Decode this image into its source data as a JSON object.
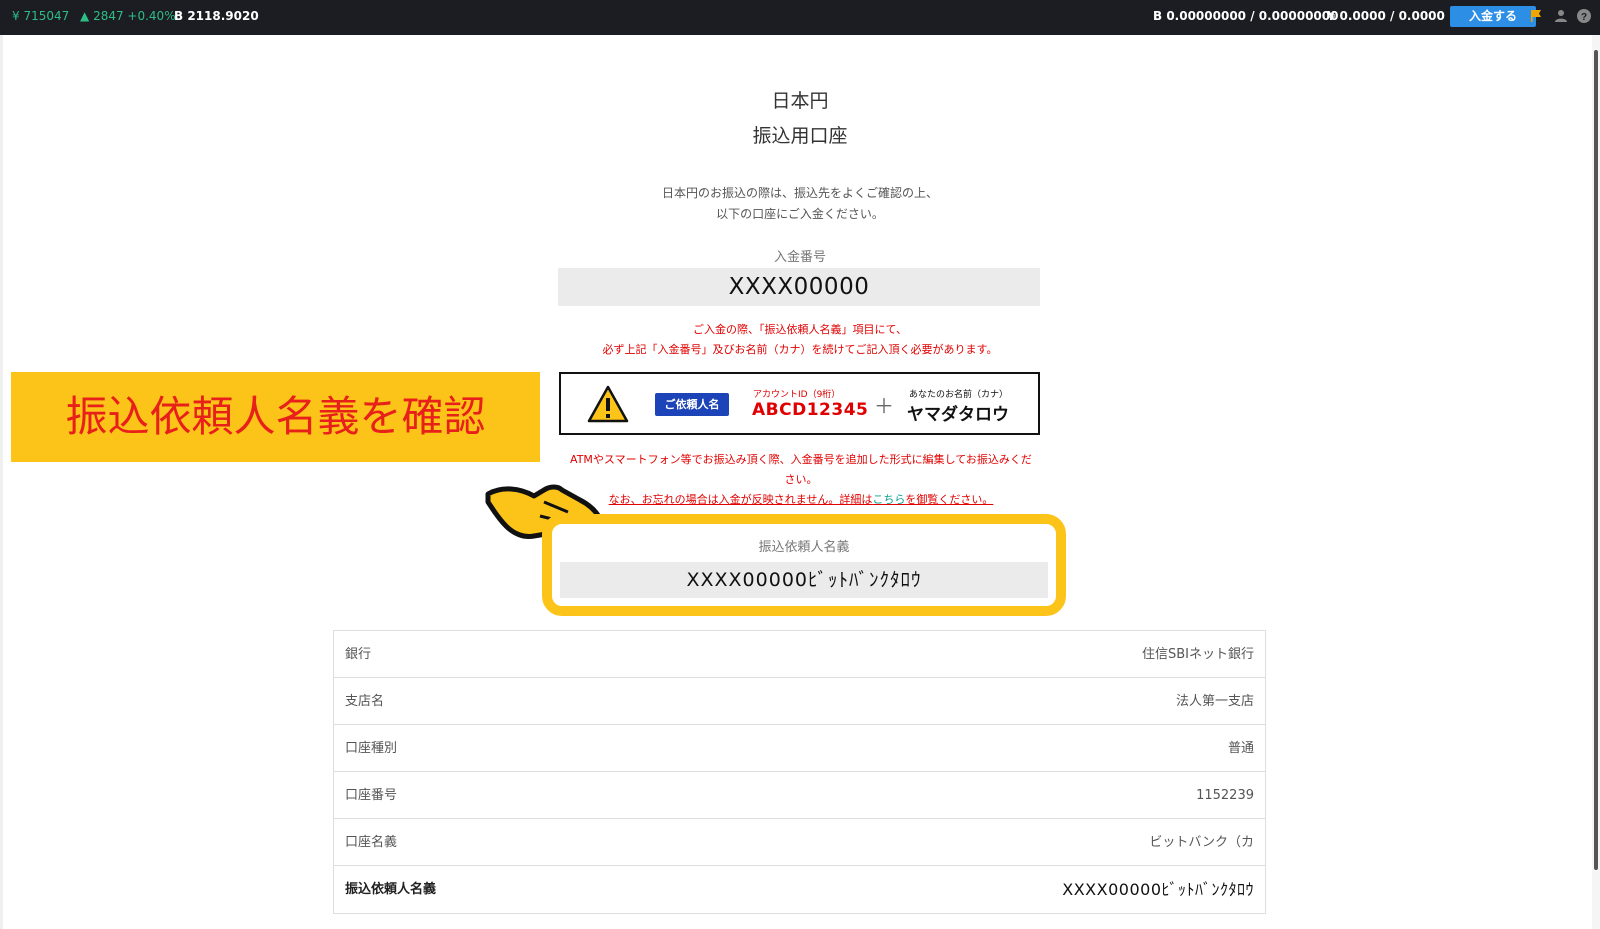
{
  "topbar": {
    "jpy_rate": "¥ 715047",
    "change": "2847 +0.40%",
    "btc_rate": "B 2118.9020",
    "btc_balance": "B 0.00000000 / 0.00000000",
    "jpy_balance": "¥ 0.0000 / 0.0000",
    "deposit_button": "入金する"
  },
  "header": {
    "title1": "日本円",
    "title2": "振込用口座"
  },
  "description": {
    "line1": "日本円のお振込の際は、振込先をよくご確認の上、",
    "line2": "以下の口座にご入金ください。"
  },
  "deposit_number": {
    "label": "入金番号",
    "value": "XXXX00000"
  },
  "notice": {
    "line1": "ご入金の際、「振込依頼人名義」項目にて、",
    "line2": "必ず上記「入金番号」及びお名前（カナ）を続けてご記入頂く必要があります。"
  },
  "example": {
    "tag": "ご依頼人名",
    "account_label": "アカウントID（9桁）",
    "account_value": "ABCD12345",
    "plus": "＋",
    "name_label": "あなたのお名前（カナ）",
    "name_value": "ヤマダタロウ"
  },
  "callout": {
    "text": "振込依頼人名義を確認"
  },
  "notice2": {
    "line1": "ATMやスマートフォン等でお振込み頂く際、入金番号を追加した形式に編集してお振込みくだ",
    "line2": "さい。",
    "link_prefix": "なお、お忘れの場合は入金が反映されません。詳細は",
    "link_text": "こちら",
    "link_suffix": "を御覧ください。"
  },
  "payer": {
    "label": "振込依頼人名義",
    "value": "XXXX00000ﾋﾞｯﾄﾊﾞﾝｸﾀﾛｳ"
  },
  "bank_table": [
    {
      "label": "銀行",
      "value": "住信SBIネット銀行"
    },
    {
      "label": "支店名",
      "value": "法人第一支店"
    },
    {
      "label": "口座種別",
      "value": "普通"
    },
    {
      "label": "口座番号",
      "value": "1152239"
    },
    {
      "label": "口座名義",
      "value": "ビットバンク（カ"
    },
    {
      "label": "振込依頼人名義",
      "value": "XXXX00000ﾋﾞｯﾄﾊﾞﾝｸﾀﾛｳ"
    }
  ],
  "colors": {
    "topbar_bg": "#1b1d22",
    "accent_blue": "#2d8ee6",
    "highlight_yellow": "#fcc419",
    "warning_red": "#e00000",
    "tag_blue": "#1c43b8"
  }
}
